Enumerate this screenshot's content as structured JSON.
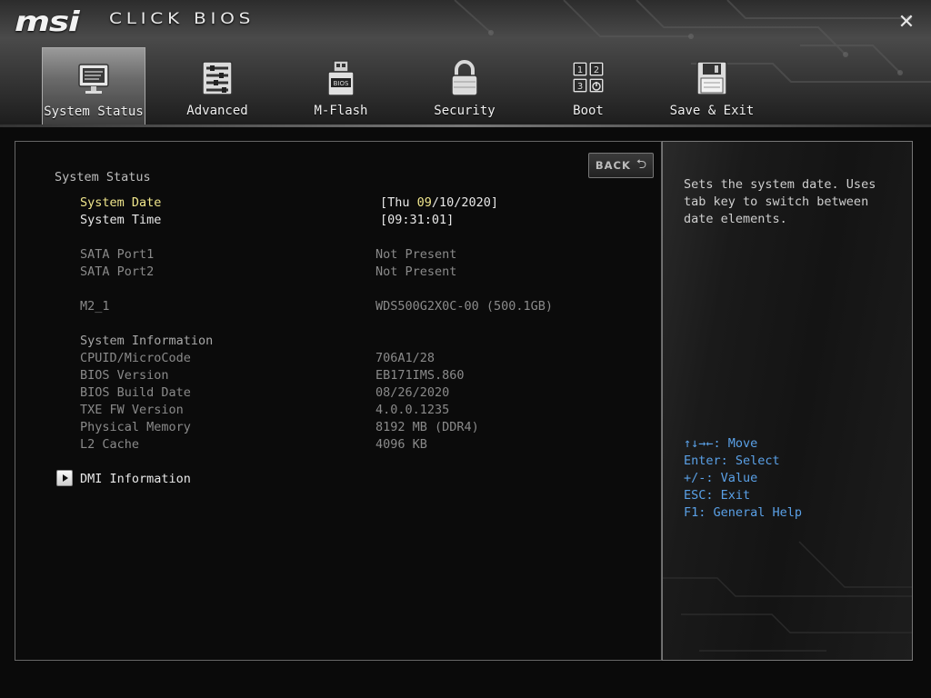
{
  "brand": {
    "logo": "msi",
    "product": "CLICK BIOS"
  },
  "close_icon": "close-icon",
  "tabs": [
    {
      "label": "System Status",
      "icon": "monitor-icon",
      "active": true
    },
    {
      "label": "Advanced",
      "icon": "sliders-icon",
      "active": false
    },
    {
      "label": "M-Flash",
      "icon": "usb-drive-icon",
      "active": false
    },
    {
      "label": "Security",
      "icon": "padlock-icon",
      "active": false
    },
    {
      "label": "Boot",
      "icon": "boot-order-icon",
      "active": false
    },
    {
      "label": "Save & Exit",
      "icon": "floppy-disk-icon",
      "active": false
    }
  ],
  "boot_icon_digits": [
    "1",
    "2",
    "3"
  ],
  "usb_label": "BIOS",
  "back_button": {
    "label": "BACK",
    "icon": "return-arrow-icon"
  },
  "section_title": "System Status",
  "system_date": {
    "label": "System Date",
    "prefix": "[Thu ",
    "month": "09",
    "rest": "/10/2020]"
  },
  "system_time": {
    "label": "System Time",
    "value": "[09:31:01]"
  },
  "sata": [
    {
      "label": "SATA Port1",
      "value": "Not Present"
    },
    {
      "label": "SATA Port2",
      "value": "Not Present"
    }
  ],
  "m2": {
    "label": "M2_1",
    "value": "WDS500G2X0C-00 (500.1GB)"
  },
  "system_information": {
    "title": "System Information",
    "rows": [
      {
        "label": "CPUID/MicroCode",
        "value": "706A1/28"
      },
      {
        "label": "BIOS Version",
        "value": "EB171IMS.860"
      },
      {
        "label": "BIOS Build Date",
        "value": "08/26/2020"
      },
      {
        "label": "TXE FW Version",
        "value": "4.0.0.1235"
      },
      {
        "label": "Physical Memory",
        "value": "8192 MB (DDR4)"
      },
      {
        "label": "L2 Cache",
        "value": "4096 KB"
      }
    ]
  },
  "dmi": {
    "label": "DMI Information",
    "icon": "submenu-arrow-icon"
  },
  "help": {
    "text": "Sets the system date.  Uses\ntab key to switch between\ndate elements.",
    "keys": [
      "↑↓→←: Move",
      "Enter: Select",
      "+/-: Value",
      "ESC: Exit",
      "F1: General Help"
    ]
  },
  "colors": {
    "highlight": "#f0e68c",
    "help_keys": "#5aa0e6",
    "dim_text": "#8a8a8a"
  }
}
